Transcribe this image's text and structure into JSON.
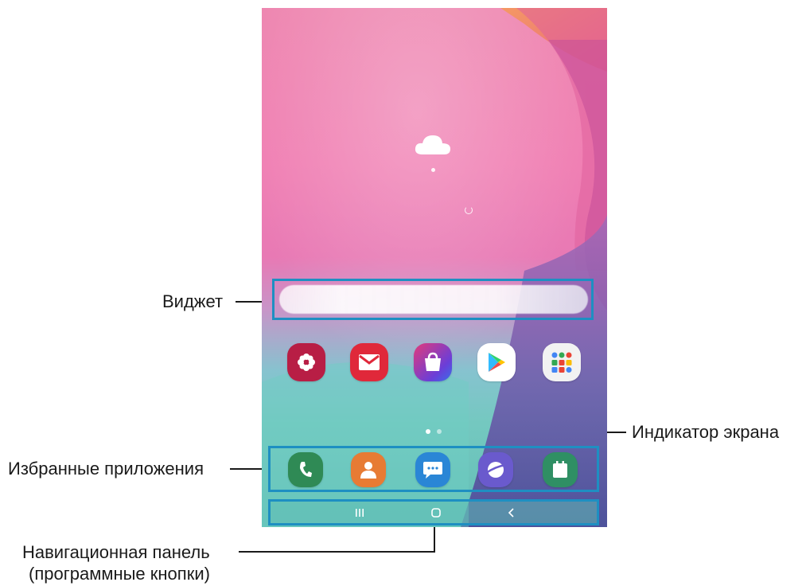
{
  "labels": {
    "widget": "Виджет",
    "screen_indicator": "Индикатор экрана",
    "favorite_apps": "Избранные приложения",
    "navigation_bar_line1": "Навигационная панель",
    "navigation_bar_line2": "(программные кнопки)"
  },
  "home_apps": [
    {
      "icon": "gallery-flower-icon",
      "color": "#b81e45"
    },
    {
      "icon": "email-envelope-icon",
      "color": "#e0283a"
    },
    {
      "icon": "galaxy-store-bag-icon",
      "color": "#7b3fd0"
    },
    {
      "icon": "play-store-icon",
      "color": "#ffffff"
    },
    {
      "icon": "google-folder-icon",
      "color": "#f2f2f2"
    }
  ],
  "dock_apps": [
    {
      "icon": "phone-icon",
      "color": "#2f8a55"
    },
    {
      "icon": "contacts-icon",
      "color": "#e77b34"
    },
    {
      "icon": "messages-icon",
      "color": "#2a86d6"
    },
    {
      "icon": "internet-browser-icon",
      "color": "#6a5acd"
    },
    {
      "icon": "calendar-icon",
      "color": "#2f8f64"
    }
  ],
  "colors": {
    "highlight_frame": "#1e8fc2",
    "leader_line": "#1a1a1a"
  }
}
